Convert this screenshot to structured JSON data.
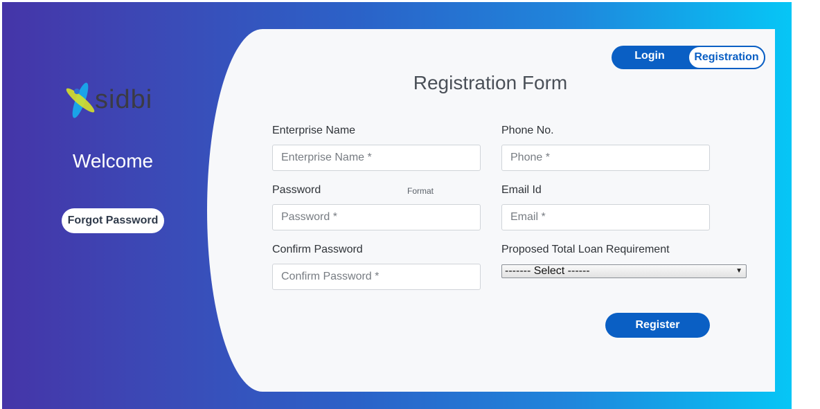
{
  "brand": {
    "logo_text": "sidbi"
  },
  "left_panel": {
    "welcome": "Welcome",
    "forgot_label": "Forgot Password"
  },
  "tabs": {
    "login": "Login",
    "registration": "Registration",
    "active": "Registration"
  },
  "form": {
    "title": "Registration Form",
    "enterprise_name": {
      "label": "Enterprise Name",
      "placeholder": "Enterprise Name *",
      "value": ""
    },
    "phone": {
      "label": "Phone No.",
      "placeholder": "Phone *",
      "value": ""
    },
    "password": {
      "label": "Password",
      "placeholder": "Password *",
      "value": "",
      "format_link": "Format"
    },
    "email": {
      "label": "Email Id",
      "placeholder": "Email *",
      "value": ""
    },
    "confirm_password": {
      "label": "Confirm Password",
      "placeholder": "Confirm Password *",
      "value": ""
    },
    "loan": {
      "label": "Proposed Total Loan Requirement",
      "selected": "------- Select ------"
    },
    "register_label": "Register"
  },
  "colors": {
    "primary": "#0a5fc4",
    "gradient_start": "#4535a8",
    "gradient_end": "#06c6f6",
    "card_bg": "#f7f8fa"
  }
}
